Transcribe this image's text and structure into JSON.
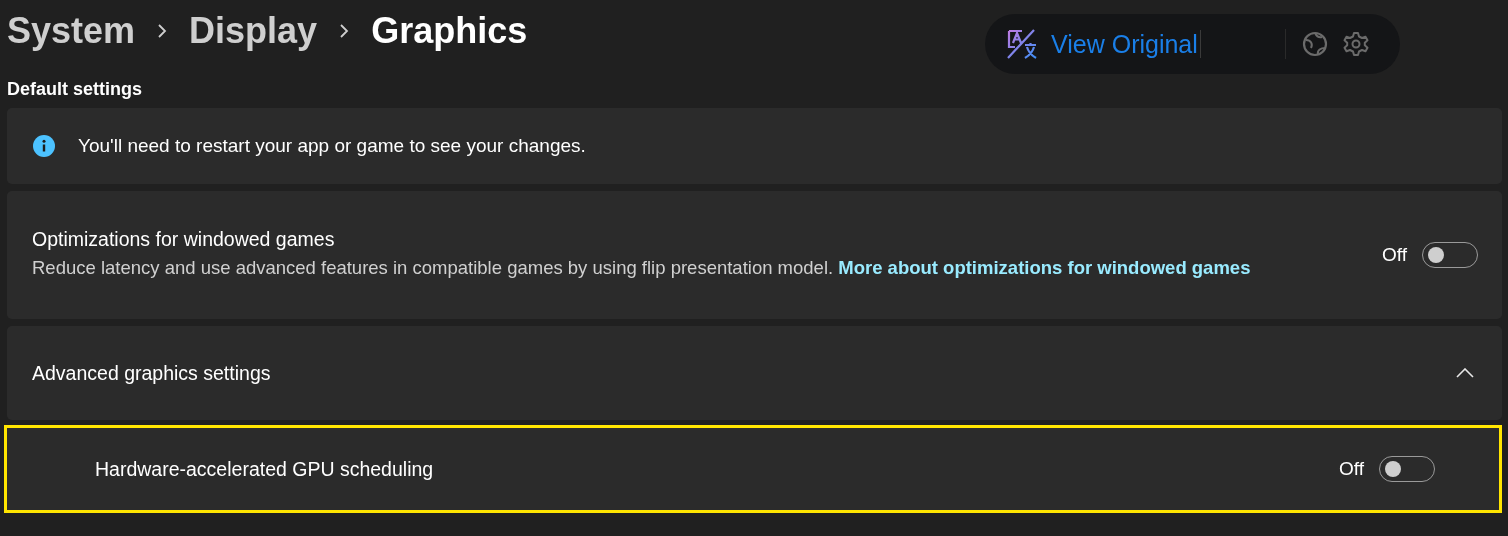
{
  "breadcrumb": [
    {
      "label": "System",
      "selected": false
    },
    {
      "label": "Display",
      "selected": false
    },
    {
      "label": "Graphics",
      "selected": true
    }
  ],
  "translate_bar": {
    "button": "View Original"
  },
  "section_title": "Default settings",
  "info": {
    "text": "You'll need to restart your app or game to see your changes."
  },
  "windowed": {
    "title": "Optimizations for windowed games",
    "description": "Reduce latency and use advanced features in compatible games by using flip presentation model.",
    "link": "More about optimizations for windowed games",
    "state_label": "Off",
    "on": false
  },
  "advanced": {
    "title": "Advanced graphics settings",
    "expanded": true,
    "items": [
      {
        "label": "Hardware-accelerated GPU scheduling",
        "state_label": "Off",
        "on": false,
        "highlighted": true
      }
    ]
  }
}
